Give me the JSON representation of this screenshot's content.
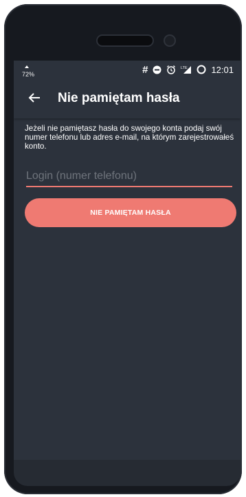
{
  "status_bar": {
    "left_indicator": "72%",
    "icons": [
      "hash-icon",
      "minus-circle-icon",
      "alarm-icon",
      "lte-signal-icon",
      "battery-icon"
    ],
    "time": "12:01"
  },
  "app_bar": {
    "back_icon": "arrow-left-icon",
    "title": "Nie pamiętam hasła"
  },
  "form": {
    "description": "Jeżeli nie pamiętasz hasła do swojego konta podaj swój numer telefonu lub adres e-mail, na którym zarejestrowałeś konto.",
    "login_value": "",
    "login_placeholder": "Login (numer telefonu)",
    "submit_label": "NIE PAMIĘTAM HASŁA"
  },
  "colors": {
    "background": "#2c323c",
    "accent": "#ef7a72",
    "text": "#ffffff",
    "placeholder": "#6f747c"
  }
}
